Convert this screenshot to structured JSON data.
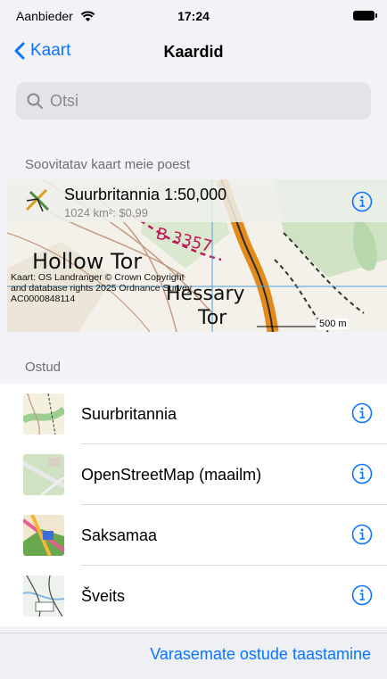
{
  "status": {
    "carrier": "Aanbieder",
    "time": "17:24"
  },
  "nav": {
    "back_label": "Kaart",
    "title": "Kaardid"
  },
  "search": {
    "placeholder": "Otsi"
  },
  "recommended": {
    "header": "Soovitatav kaart meie poest",
    "map_name": "Suurbritannia 1:50,000",
    "map_info": "1024 km²: $0.99",
    "labels": {
      "place1": "Hollow Tor",
      "place2": "Hessary",
      "place3": "Tor",
      "road": "B 3357"
    },
    "credit": "Kaart: OS Landranger © Crown Copyright and database rights 2025 Ordnance Survey AC0000848114",
    "scale": "500 m"
  },
  "purchases": {
    "header": "Ostud",
    "items": [
      {
        "label": "Suurbritannia"
      },
      {
        "label": "OpenStreetMap (maailm)"
      },
      {
        "label": "Saksamaa"
      },
      {
        "label": "Šveits"
      }
    ]
  },
  "footer": {
    "restore_label": "Varasemate ostude taastamine"
  },
  "colors": {
    "accent": "#0a74ff",
    "background": "#f2f2f7"
  }
}
